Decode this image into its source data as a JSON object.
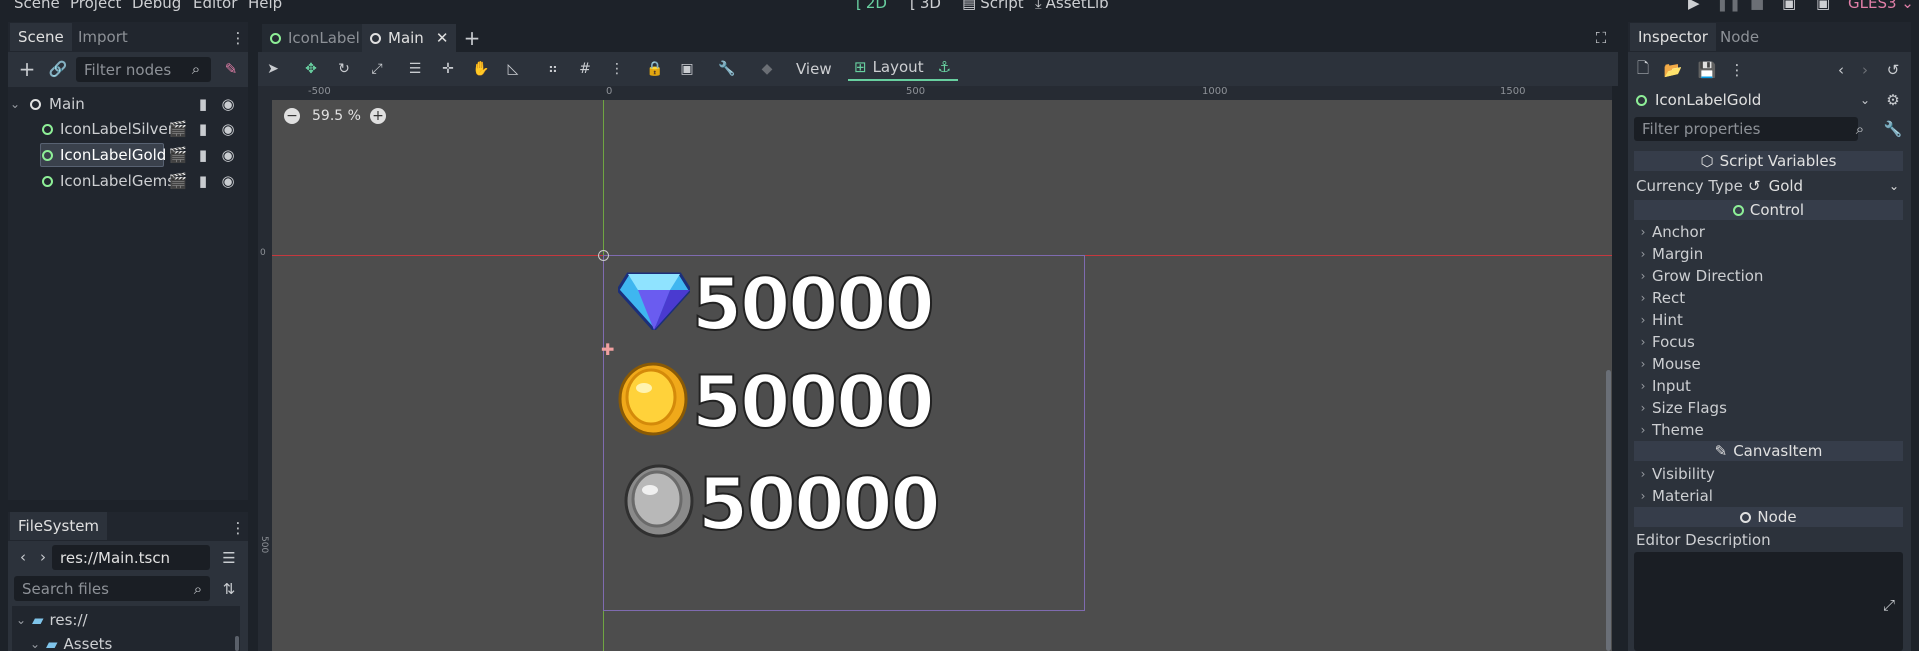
{
  "menu": [
    "Scene",
    "Project",
    "Debug",
    "Editor",
    "Help"
  ],
  "modes": [
    "2D",
    "3D",
    "Script",
    "AssetLib"
  ],
  "renderer": "GLES3",
  "scene_dock": {
    "tabs": [
      "Scene",
      "Import"
    ],
    "filter_placeholder": "Filter nodes",
    "tree": {
      "root": "Main",
      "children": [
        "IconLabelSilver",
        "IconLabelGold",
        "IconLabelGems"
      ],
      "selected": "IconLabelGold"
    }
  },
  "filesystem_dock": {
    "tab": "FileSystem",
    "path": "res://Main.tscn",
    "search_placeholder": "Search files",
    "items": [
      "res://",
      "Assets"
    ]
  },
  "editor_tabs": [
    "IconLabel",
    "Main"
  ],
  "toolbar": {
    "view_label": "View",
    "layout_label": "Layout"
  },
  "ruler_labels": [
    "-500",
    "0",
    "500",
    "1000",
    "1500"
  ],
  "vruler_labels": [
    "0",
    "500"
  ],
  "zoom": "59.5 %",
  "canvas_labels": [
    {
      "icon": "gem-icon",
      "value": "50000"
    },
    {
      "icon": "gold-coin-icon",
      "value": "50000"
    },
    {
      "icon": "silver-coin-icon",
      "value": "50000"
    }
  ],
  "inspector": {
    "tabs": [
      "Inspector",
      "Node"
    ],
    "object": "IconLabelGold",
    "filter_placeholder": "Filter properties",
    "script_variables_header": "Script Variables",
    "currency_type_label": "Currency Type",
    "currency_type_value": "Gold",
    "control_header": "Control",
    "control_props": [
      "Anchor",
      "Margin",
      "Grow Direction",
      "Rect",
      "Hint",
      "Focus",
      "Mouse",
      "Input",
      "Size Flags",
      "Theme"
    ],
    "canvasitem_header": "CanvasItem",
    "canvasitem_props": [
      "Visibility",
      "Material"
    ],
    "node_header": "Node",
    "editor_description_label": "Editor Description"
  },
  "colors": {
    "accent_green": "#68d0a0",
    "node_green": "#8eef97",
    "node_blue": "#8da5f3",
    "canvas_bg": "#4d4d4d",
    "renderer_pink": "#e17fa8"
  }
}
